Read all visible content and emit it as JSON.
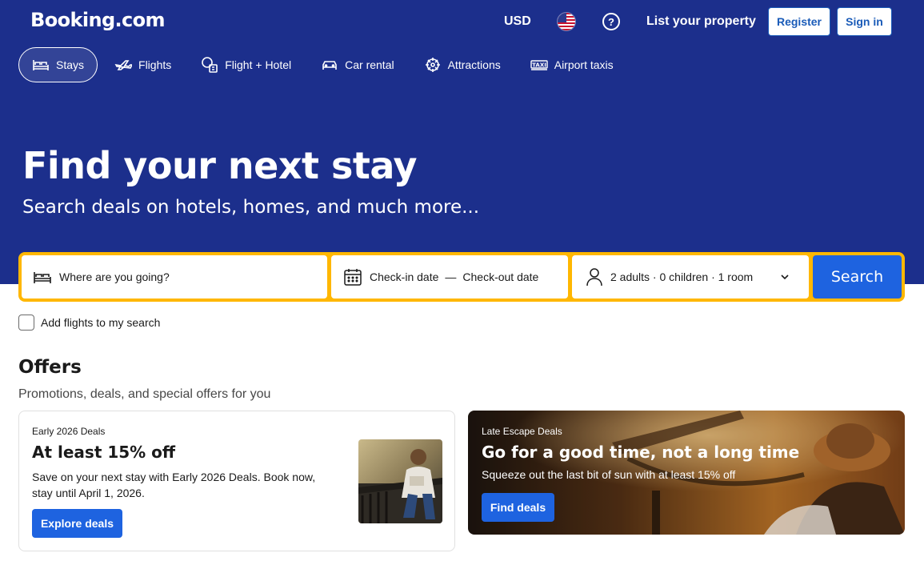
{
  "header": {
    "logo": "Booking.com",
    "currency": "USD",
    "flag_icon": "us-flag-icon",
    "help_icon": "help-circle-icon",
    "help_glyph": "?",
    "list_property": "List your property",
    "register": "Register",
    "sign_in": "Sign in"
  },
  "nav": {
    "items": [
      {
        "label": "Stays",
        "icon": "bed-icon",
        "active": true
      },
      {
        "label": "Flights",
        "icon": "plane-icon",
        "active": false
      },
      {
        "label": "Flight + Hotel",
        "icon": "flight-hotel-icon",
        "active": false
      },
      {
        "label": "Car rental",
        "icon": "car-icon",
        "active": false
      },
      {
        "label": "Attractions",
        "icon": "attractions-icon",
        "active": false
      },
      {
        "label": "Airport taxis",
        "icon": "taxi-icon",
        "active": false
      }
    ]
  },
  "hero": {
    "title": "Find your next stay",
    "subtitle": "Search deals on hotels, homes, and much more..."
  },
  "search": {
    "destination_placeholder": "Where are you going?",
    "checkin": "Check-in date",
    "dash": "—",
    "checkout": "Check-out date",
    "guests": "2 adults · 0 children · 1 room",
    "button": "Search"
  },
  "add_flights": {
    "label": "Add flights to my search",
    "checked": false
  },
  "offers": {
    "title": "Offers",
    "subtitle": "Promotions, deals, and special offers for you",
    "cards": [
      {
        "kicker": "Early 2026 Deals",
        "title": "At least 15% off",
        "text": "Save on your next stay with Early 2026 Deals. Book now, stay until April 1, 2026.",
        "button": "Explore deals"
      },
      {
        "kicker": "Late Escape Deals",
        "title": "Go for a good time, not a long time",
        "text": "Squeeze out the last bit of sun with at least 15% off",
        "button": "Find deals"
      }
    ]
  },
  "colors": {
    "brand_blue": "#1c2f8c",
    "action_blue": "#1e63e0",
    "search_border": "#ffb700"
  }
}
